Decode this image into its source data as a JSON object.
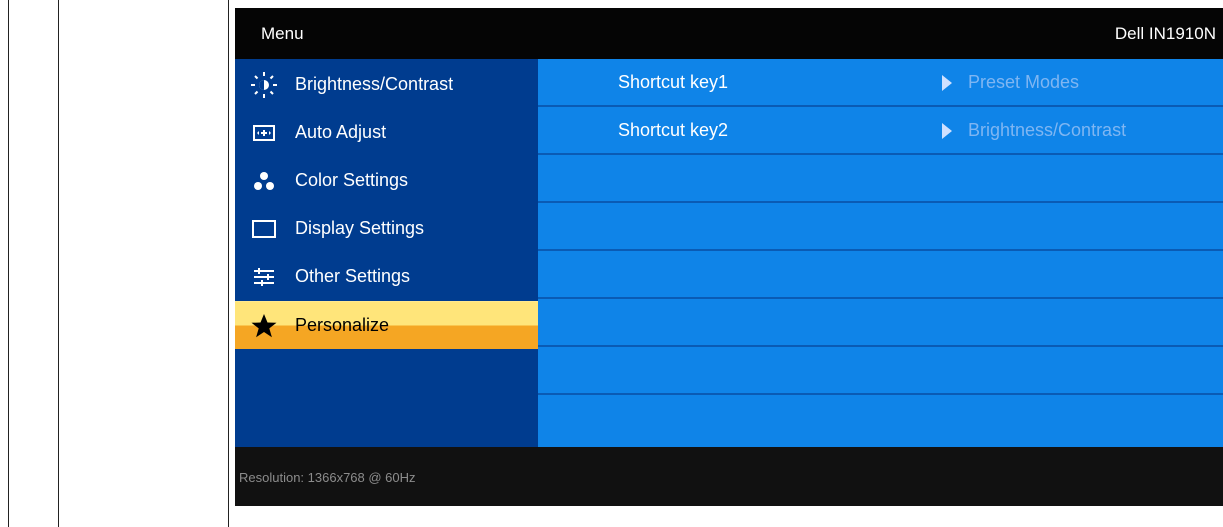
{
  "header": {
    "menu_title": "Menu",
    "model": "Dell IN1910N"
  },
  "sidebar": {
    "items": [
      {
        "label": "Brightness/Contrast",
        "icon": "brightness-icon",
        "selected": false
      },
      {
        "label": "Auto Adjust",
        "icon": "auto-adjust-icon",
        "selected": false
      },
      {
        "label": "Color Settings",
        "icon": "color-settings-icon",
        "selected": false
      },
      {
        "label": "Display Settings",
        "icon": "display-settings-icon",
        "selected": false
      },
      {
        "label": "Other Settings",
        "icon": "other-settings-icon",
        "selected": false
      },
      {
        "label": "Personalize",
        "icon": "star-icon",
        "selected": true
      }
    ]
  },
  "personalize": {
    "rows": [
      {
        "key": "Shortcut key1",
        "value": "Preset Modes"
      },
      {
        "key": "Shortcut key2",
        "value": "Brightness/Contrast"
      },
      {
        "key": "",
        "value": ""
      },
      {
        "key": "",
        "value": ""
      },
      {
        "key": "",
        "value": ""
      },
      {
        "key": "",
        "value": ""
      },
      {
        "key": "",
        "value": ""
      },
      {
        "key": "",
        "value": ""
      }
    ]
  },
  "footer": {
    "resolution": "Resolution:  1366x768 @ 60Hz"
  },
  "colors": {
    "left_panel": "#003c8f",
    "right_panel": "#0f84e8",
    "selected_top": "#ffe57a",
    "selected_bottom": "#f5a623",
    "value_text": "#7fb6f2"
  }
}
